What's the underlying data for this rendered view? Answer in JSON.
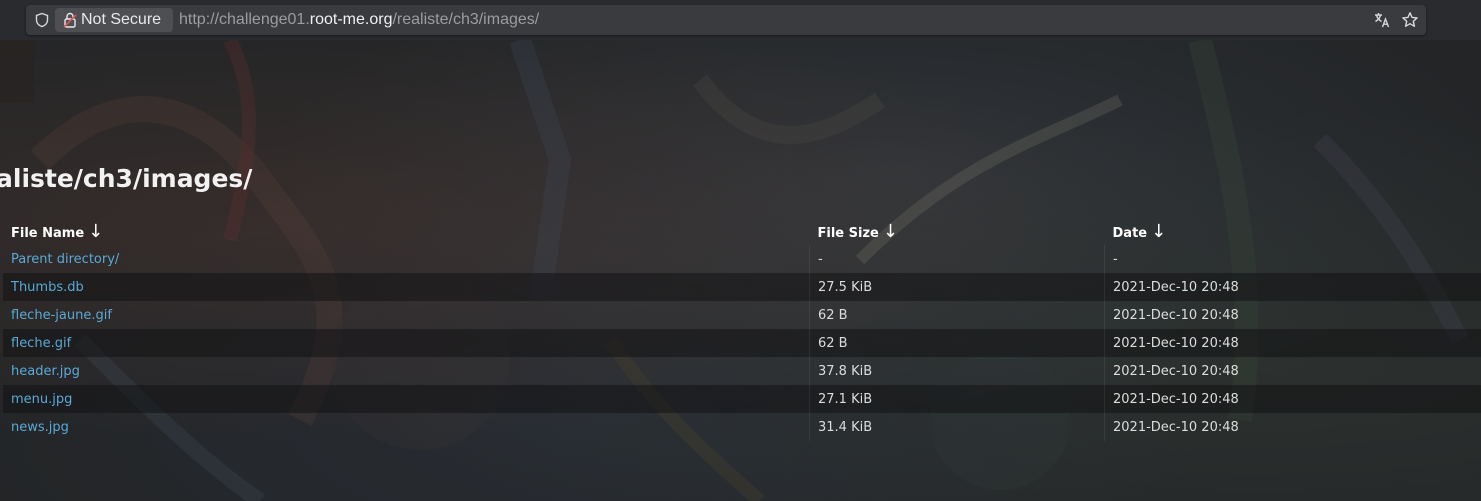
{
  "browser": {
    "security_label": "Not Secure",
    "url_prefix": "http://challenge01.",
    "url_host": "root-me.org",
    "url_path": "/realiste/ch3/images/",
    "icons": {
      "shield": "shield-icon",
      "lock": "lock-icon",
      "translate": "translate-icon",
      "bookmark": "star-icon"
    }
  },
  "page": {
    "heading": "aliste/ch3/images/",
    "columns": [
      {
        "label": "File Name",
        "sort_arrow": "↓"
      },
      {
        "label": "File Size",
        "sort_arrow": "↓"
      },
      {
        "label": "Date",
        "sort_arrow": "↓"
      }
    ],
    "rows": [
      {
        "name": "Parent directory/",
        "size": "-",
        "date": "-"
      },
      {
        "name": "Thumbs.db",
        "size": "27.5 KiB",
        "date": "2021-Dec-10 20:48"
      },
      {
        "name": "fleche-jaune.gif",
        "size": "62 B",
        "date": "2021-Dec-10 20:48"
      },
      {
        "name": "fleche.gif",
        "size": "62 B",
        "date": "2021-Dec-10 20:48"
      },
      {
        "name": "header.jpg",
        "size": "37.8 KiB",
        "date": "2021-Dec-10 20:48"
      },
      {
        "name": "menu.jpg",
        "size": "27.1 KiB",
        "date": "2021-Dec-10 20:48"
      },
      {
        "name": "news.jpg",
        "size": "31.4 KiB",
        "date": "2021-Dec-10 20:48"
      }
    ]
  },
  "colors": {
    "link": "#5aa9d6",
    "text": "#dcdcdc",
    "heading": "#f2f2f2",
    "chrome_bg": "#2a2b2e",
    "urlbar_bg": "#3a3b3f"
  }
}
